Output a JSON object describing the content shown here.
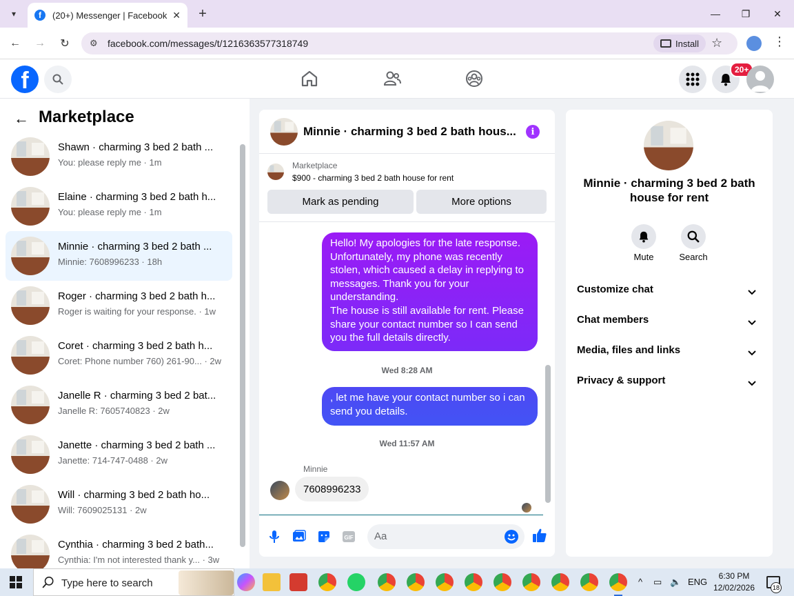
{
  "browser": {
    "tab_title": "(20+) Messenger | Facebook",
    "url": "facebook.com/messages/t/1216363577318749",
    "install_label": "Install"
  },
  "header": {
    "notification_badge": "20+"
  },
  "marketplace": {
    "title": "Marketplace",
    "conversations": [
      {
        "name": "Shawn · charming 3 bed 2 bath ...",
        "preview": "You: please reply me · 1m"
      },
      {
        "name": "Elaine · charming 3 bed 2 bath h...",
        "preview": "You: please reply me · 1m"
      },
      {
        "name": "Minnie · charming 3 bed 2 bath ...",
        "preview": "Minnie: 7608996233 · 18h"
      },
      {
        "name": "Roger · charming 3 bed 2 bath h...",
        "preview": "Roger is waiting for your response. · 1w"
      },
      {
        "name": "Coret · charming 3 bed 2 bath h...",
        "preview": "Coret: Phone number 760) 261-90...  · 2w"
      },
      {
        "name": "Janelle R · charming 3 bed 2 bat...",
        "preview": "Janelle R: 7605740823 · 2w"
      },
      {
        "name": "Janette · charming 3 bed 2 bath ...",
        "preview": "Janette: 714-747-0488 · 2w"
      },
      {
        "name": "Will · charming 3 bed 2 bath ho...",
        "preview": "Will: 7609025131 · 2w"
      },
      {
        "name": "Cynthia · charming 3 bed 2 bath...",
        "preview": "Cynthia: I'm not interested thank y...  · 3w"
      }
    ]
  },
  "chat": {
    "title": "Minnie · charming 3 bed 2 bath hous...",
    "marketplace_label": "Marketplace",
    "listing": "$900 - charming 3 bed 2 bath house for rent",
    "mark_pending": "Mark as pending",
    "more_options": "More options",
    "msg1_lines": [
      "Hello! My apologies for the late response.",
      "Unfortunately, my phone was recently",
      "stolen, which caused a delay in replying to",
      "messages. Thank you for your",
      "understanding.",
      "The house is still available for rent. Please",
      "share your contact number so I can send",
      "you the full details directly."
    ],
    "ts1": "Wed 8:28 AM",
    "msg2_lines": [
      ", let me have your contact number so i can",
      "send you details."
    ],
    "ts2": "Wed 11:57 AM",
    "sender": "Minnie",
    "incoming": "7608996233",
    "placeholder": "Aa"
  },
  "details": {
    "name_line1": "Minnie · charming 3 bed 2 bath",
    "name_line2": "house for rent",
    "mute": "Mute",
    "search": "Search",
    "sections": [
      "Customize chat",
      "Chat members",
      "Media, files and links",
      "Privacy & support"
    ]
  },
  "taskbar": {
    "search_placeholder": "Type here to search",
    "language": "ENG",
    "time": "6:30 PM",
    "date": "12/02/2026",
    "notif_count": "18"
  }
}
